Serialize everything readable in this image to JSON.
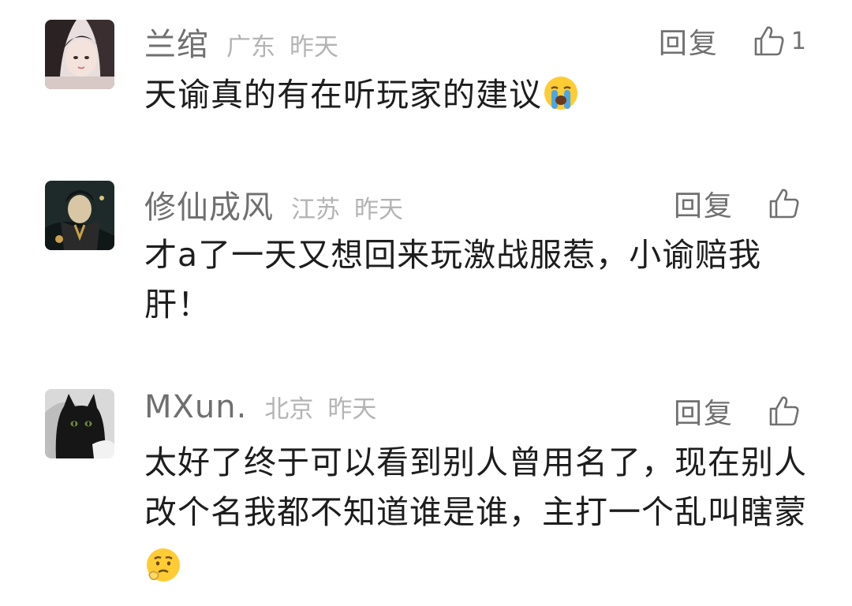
{
  "comments": [
    {
      "username": "兰绾",
      "location": "广东",
      "time": "昨天",
      "reply_label": "回复",
      "like_count": "1",
      "text": "天谕真的有在听玩家的建议",
      "emoji": "loudly-crying-face"
    },
    {
      "username": "修仙成风",
      "location": "江苏",
      "time": "昨天",
      "reply_label": "回复",
      "like_count": "",
      "text_line1": "才a了一天又想回来玩激战服惹，小谕赔我",
      "text_line2": "肝！"
    },
    {
      "username": "MXun.",
      "location": "北京",
      "time": "昨天",
      "reply_label": "回复",
      "like_count": "",
      "text_line1": "太好了终于可以看到别人曾用名了，现在别人",
      "text_line2": "改个名我都不知道谁是谁，主打一个乱叫瞎蒙",
      "emoji": "thinking-worried-face"
    }
  ],
  "colors": {
    "background": "#ffffff",
    "username": "#6f6f6f",
    "meta": "#b4b4b4",
    "text": "#1d1d1d",
    "action": "#707070"
  }
}
